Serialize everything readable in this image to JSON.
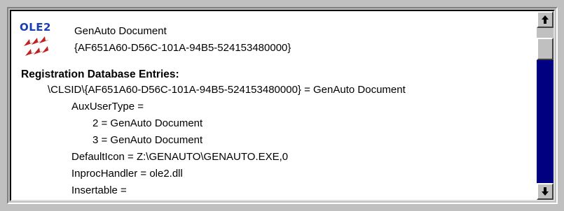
{
  "header": {
    "logo_text": "OLE2",
    "title": "GenAuto Document",
    "clsid": "{AF651A60-D56C-101A-94B5-524153480000}"
  },
  "section_title": "Registration Database Entries:",
  "entries": [
    "\\CLSID\\{AF651A60-D56C-101A-94B5-524153480000} = GenAuto Document",
    "AuxUserType =",
    "2 = GenAuto Document",
    "3 = GenAuto Document",
    "DefaultIcon = Z:\\GENAUTO\\GENAUTO.EXE,0",
    "InprocHandler = ole2.dll",
    "Insertable ="
  ],
  "colors": {
    "logo": "#1a3fb4",
    "arrows": "#c02020",
    "scroll_track": "#000080",
    "face": "#c0c0c0"
  },
  "icons": {
    "scroll_up": "up-arrow-icon",
    "scroll_down": "down-arrow-icon",
    "object": "ole2-logo-icon"
  }
}
